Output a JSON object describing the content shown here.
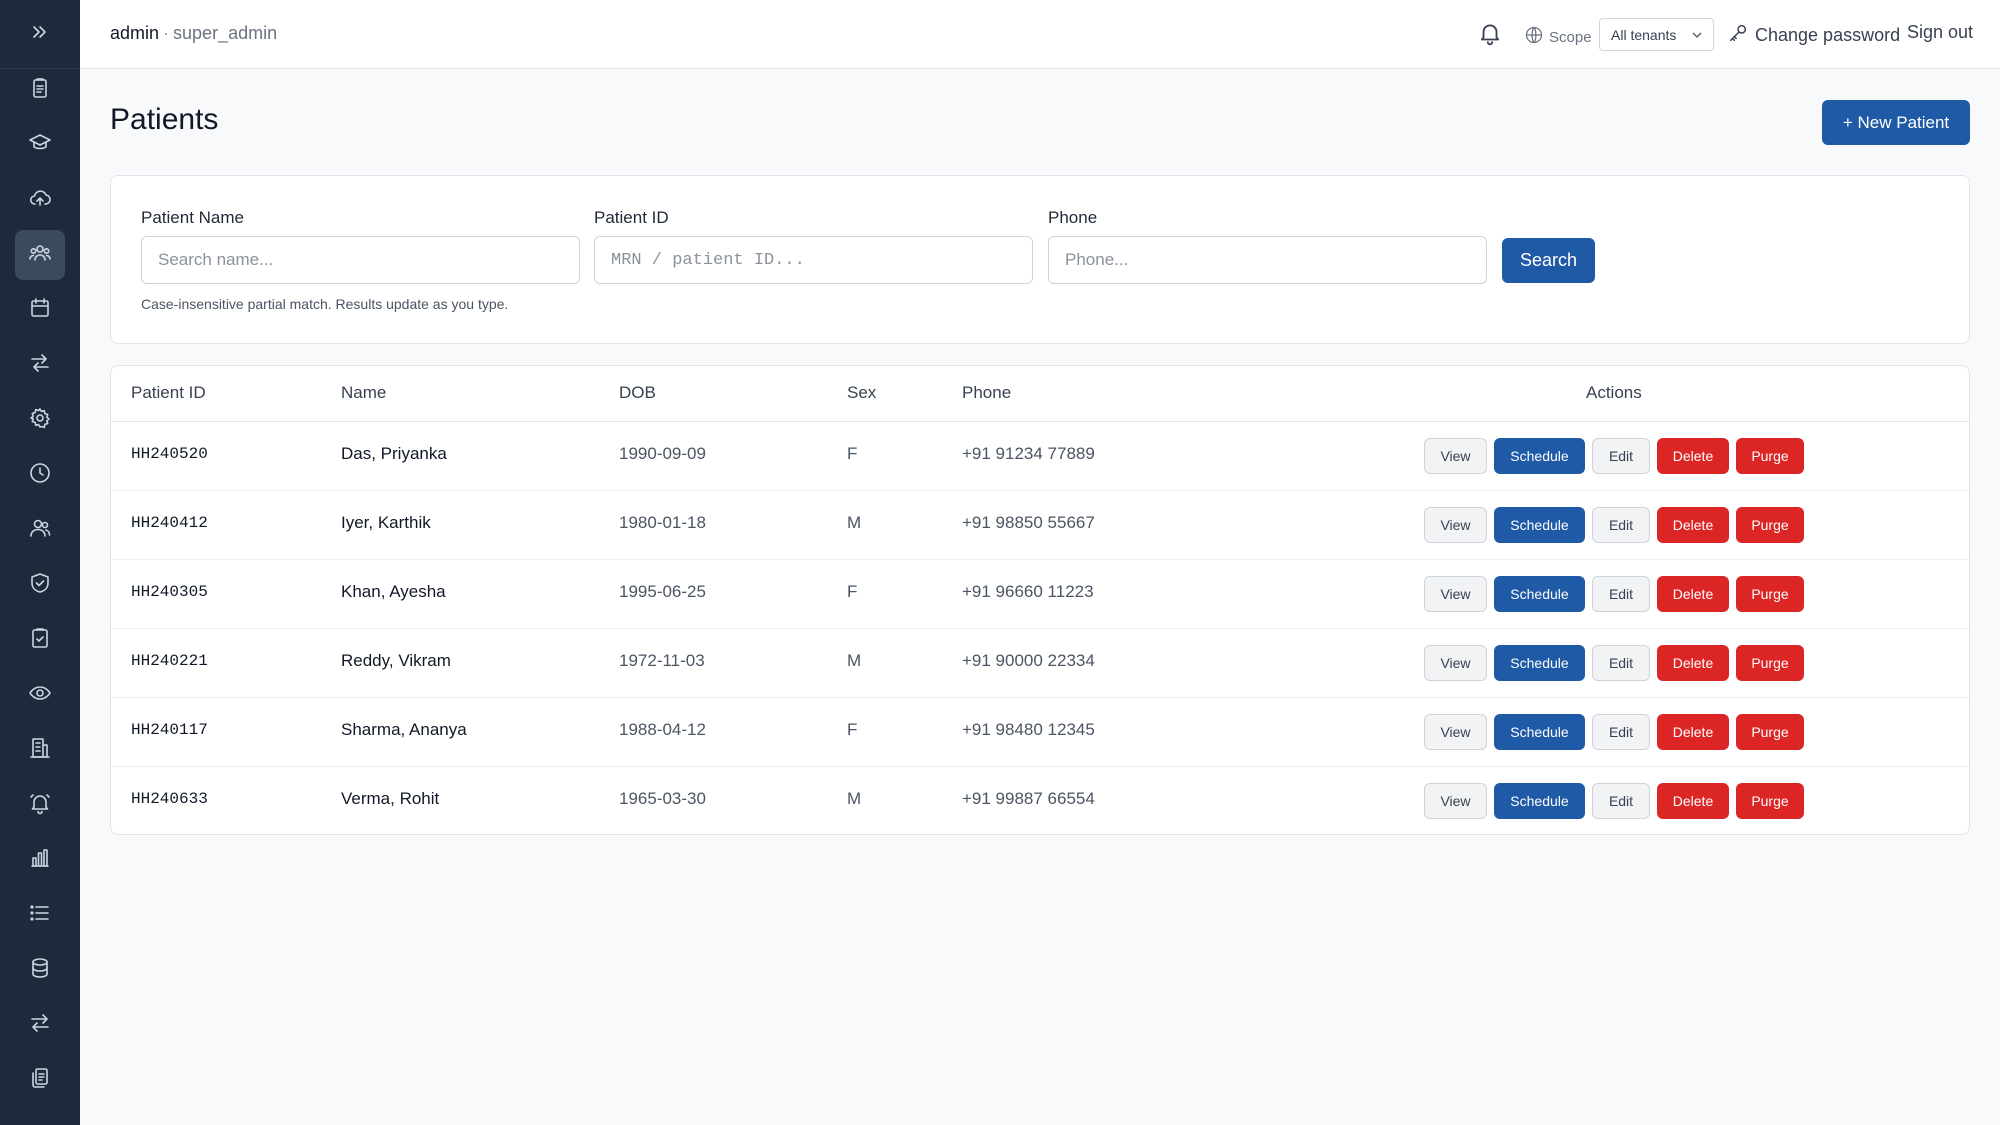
{
  "header": {
    "user": "admin",
    "separator": "·",
    "role": "super_admin",
    "scope_label": "Scope",
    "tenant_selected": "All tenants",
    "change_password": "Change password",
    "sign_out": "Sign out"
  },
  "sidebar": {
    "items": [
      {
        "icon": "clipboard-list-icon"
      },
      {
        "icon": "graduation-cap-icon"
      },
      {
        "icon": "cloud-upload-icon"
      },
      {
        "icon": "patients-group-icon",
        "active": true
      },
      {
        "icon": "calendar-icon"
      },
      {
        "icon": "transfer-arrows-icon"
      },
      {
        "icon": "gear-icon"
      },
      {
        "icon": "clock-icon"
      },
      {
        "icon": "users-icon"
      },
      {
        "icon": "shield-check-icon"
      },
      {
        "icon": "clipboard-check-icon"
      },
      {
        "icon": "eye-icon"
      },
      {
        "icon": "building-icon"
      },
      {
        "icon": "alarm-bell-icon"
      },
      {
        "icon": "bar-chart-icon"
      },
      {
        "icon": "list-icon"
      },
      {
        "icon": "database-icon"
      },
      {
        "icon": "sync-arrows-icon"
      },
      {
        "icon": "documents-icon"
      }
    ]
  },
  "page": {
    "title": "Patients",
    "new_button": "+ New Patient"
  },
  "search": {
    "name_label": "Patient Name",
    "name_placeholder": "Search name...",
    "id_label": "Patient ID",
    "id_placeholder": "MRN / patient ID...",
    "phone_label": "Phone",
    "phone_placeholder": "Phone...",
    "button": "Search",
    "hint": "Case-insensitive partial match. Results update as you type."
  },
  "table": {
    "columns": [
      "Patient ID",
      "Name",
      "DOB",
      "Sex",
      "Phone",
      "Actions"
    ],
    "action_labels": {
      "view": "View",
      "schedule": "Schedule",
      "edit": "Edit",
      "delete": "Delete",
      "purge": "Purge"
    },
    "rows": [
      {
        "id": "HH240520",
        "name": "Das, Priyanka",
        "dob": "1990-09-09",
        "sex": "F",
        "phone": "+91 91234 77889"
      },
      {
        "id": "HH240412",
        "name": "Iyer, Karthik",
        "dob": "1980-01-18",
        "sex": "M",
        "phone": "+91 98850 55667"
      },
      {
        "id": "HH240305",
        "name": "Khan, Ayesha",
        "dob": "1995-06-25",
        "sex": "F",
        "phone": "+91 96660 11223"
      },
      {
        "id": "HH240221",
        "name": "Reddy, Vikram",
        "dob": "1972-11-03",
        "sex": "M",
        "phone": "+91 90000 22334"
      },
      {
        "id": "HH240117",
        "name": "Sharma, Ananya",
        "dob": "1988-04-12",
        "sex": "F",
        "phone": "+91 98480 12345"
      },
      {
        "id": "HH240633",
        "name": "Verma, Rohit",
        "dob": "1965-03-30",
        "sex": "M",
        "phone": "+91 99887 66554"
      }
    ]
  },
  "colors": {
    "sidebar_bg": "#1e293b",
    "primary": "#1f5aa6",
    "danger": "#dc2626"
  }
}
